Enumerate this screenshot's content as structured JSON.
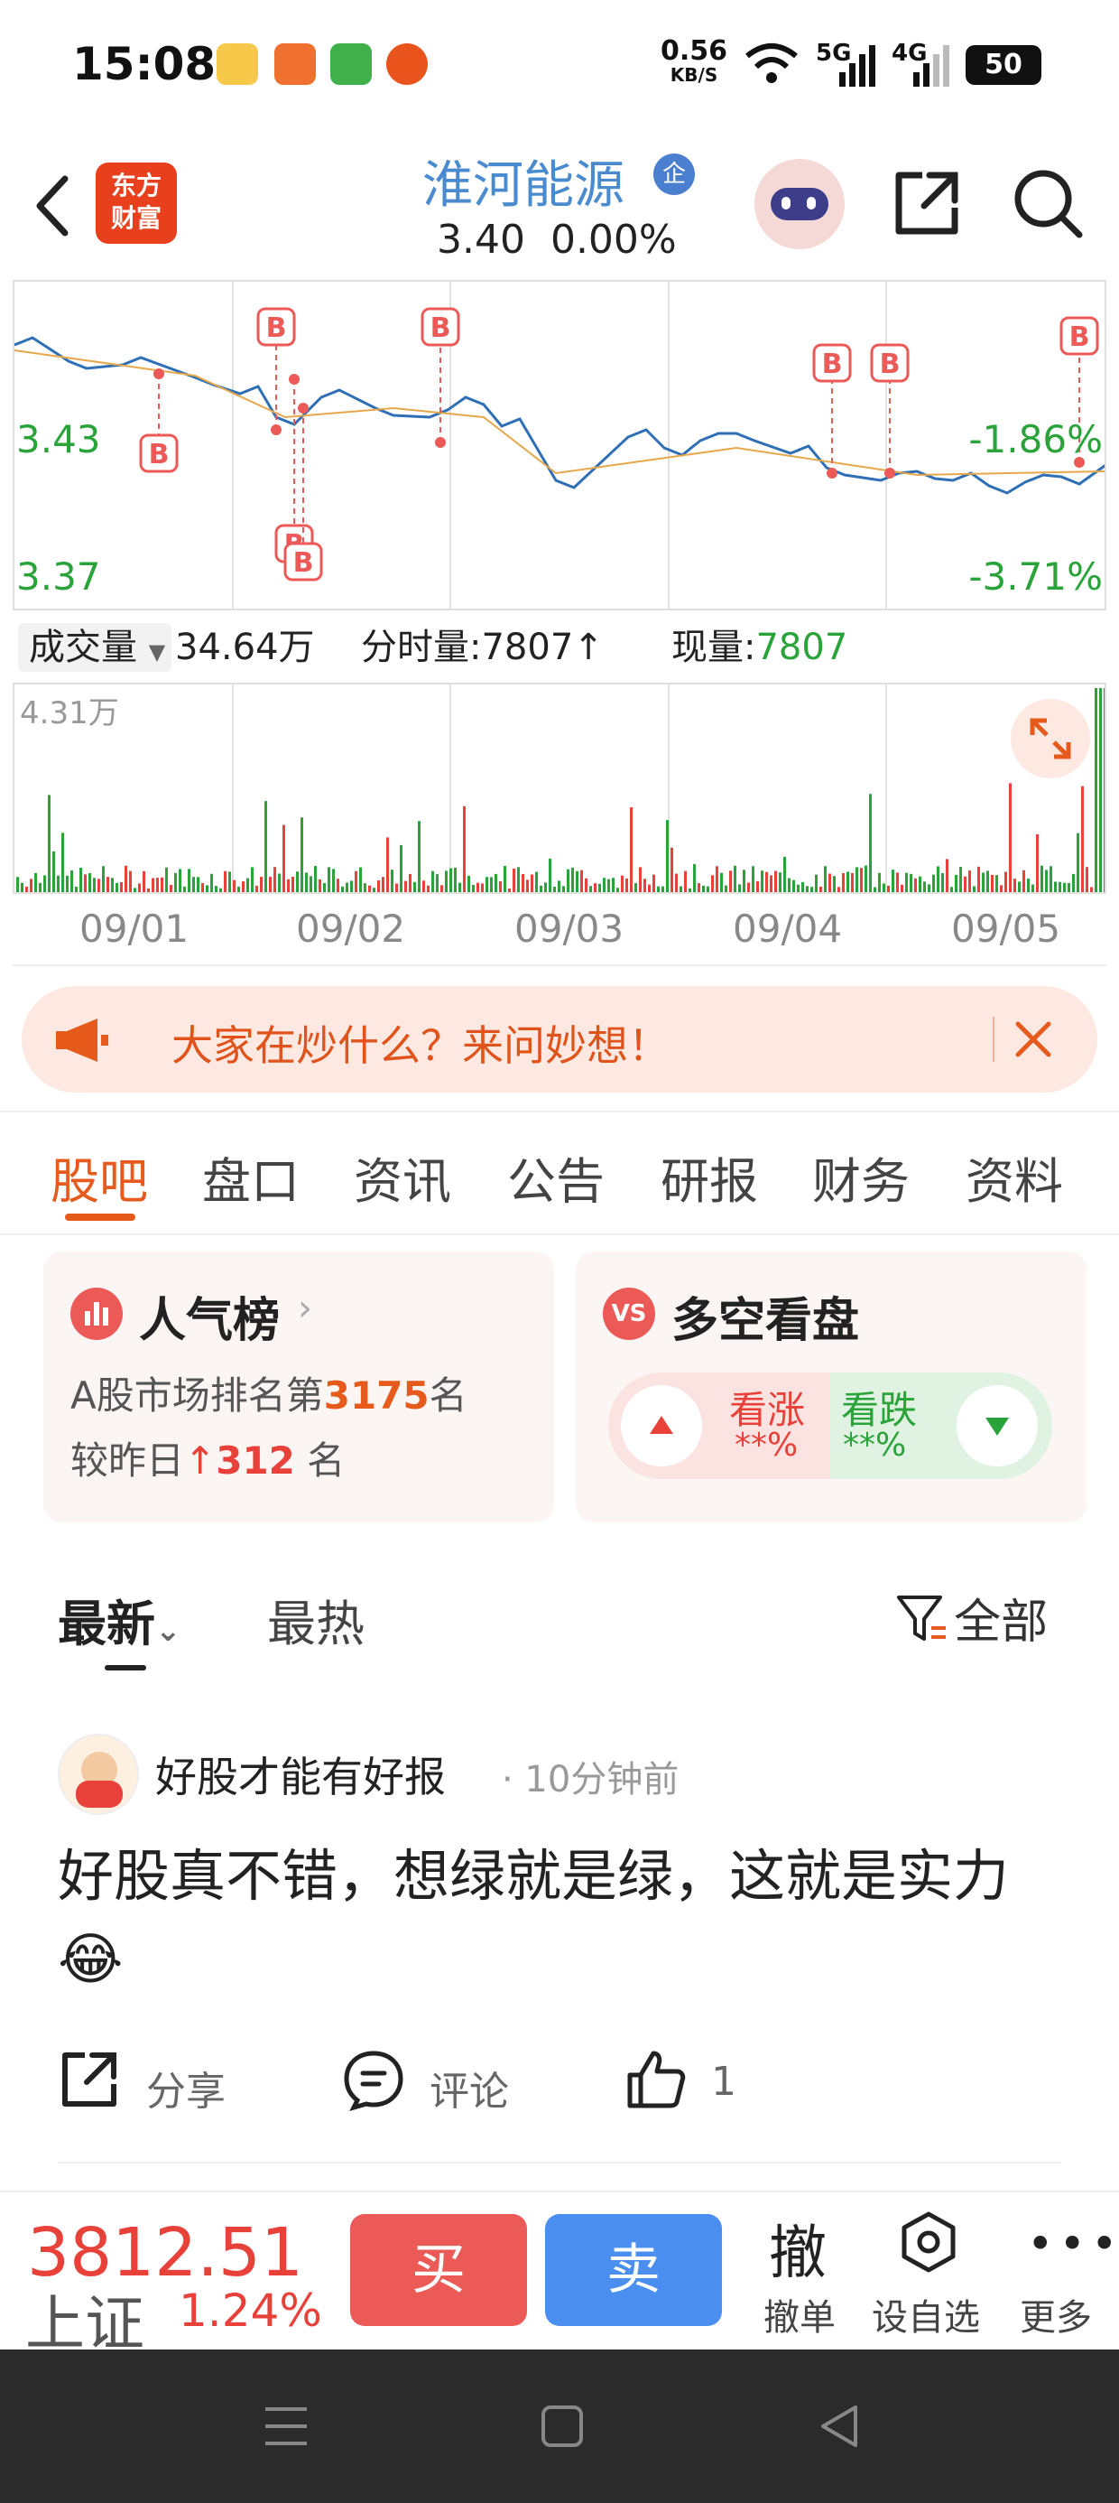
{
  "status_bar": {
    "time": "15:08",
    "speed": "0.56",
    "speed_unit": "KB/S",
    "net1": "5G",
    "net2": "4G",
    "battery": "50"
  },
  "header": {
    "logo_line1": "东方",
    "logo_line2": "财富",
    "stock_name": "淮河能源",
    "badge": "企",
    "price": "3.40",
    "change": "0.00%"
  },
  "intraday": {
    "y_high": "3.43",
    "y_low": "3.37",
    "pct_high": "-1.86%",
    "pct_low": "-3.71%",
    "buy_marker": "B"
  },
  "volume": {
    "selector": "成交量",
    "total": "34.64万",
    "minute_label": "分时量:",
    "minute_value": "7807",
    "minute_arrow": "↑",
    "current_label": "现量:",
    "current_value": "7807",
    "max_label": "4.31万"
  },
  "x_dates": [
    "09/01",
    "09/02",
    "09/03",
    "09/04",
    "09/05"
  ],
  "banner": {
    "text": "大家在炒什么？来问妙想！"
  },
  "tabs": [
    "股吧",
    "盘口",
    "资讯",
    "公告",
    "研报",
    "财务",
    "资料"
  ],
  "popularity": {
    "title": "人气榜",
    "rank_prefix": "A股市场排名第",
    "rank": "3175",
    "rank_suffix": "名",
    "change_prefix": "较昨日",
    "change_value": "312",
    "change_suffix": "名"
  },
  "sentiment": {
    "title": "多空看盘",
    "up_label": "看涨",
    "up_value": "**%",
    "down_label": "看跌",
    "down_value": "**%"
  },
  "feed": {
    "sort_latest": "最新",
    "sort_hot": "最热",
    "filter": "全部"
  },
  "post": {
    "author": "好股才能有好报",
    "time": "· 10分钟前",
    "body": "好股真不错，想绿就是绿，这就是实力😂",
    "share": "分享",
    "comment": "评论",
    "likes": "1"
  },
  "trade_bar": {
    "index_value": "3812.51",
    "index_name": "上证",
    "index_pct": "1.24%",
    "buy": "买",
    "sell": "卖",
    "cancel_icon_text": "撤",
    "cancel": "撤单",
    "watch": "设自选",
    "more": "更多"
  },
  "colors": {
    "accent": "#e65a1c",
    "up": "#e8413a",
    "down": "#2aa33a",
    "line": "#2f6fb5"
  }
}
